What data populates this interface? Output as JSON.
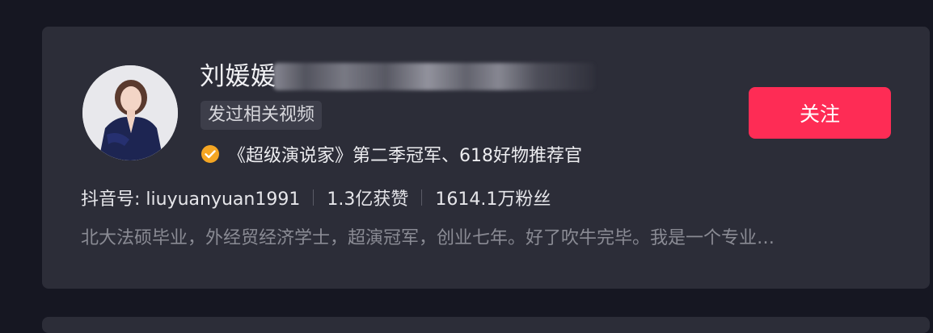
{
  "profile": {
    "name": "刘媛媛",
    "tag": "发过相关视频",
    "verification": "《超级演说家》第二季冠军、618好物推荐官",
    "follow_label": "关注",
    "stats": {
      "id": "抖音号: liuyuanyuan1991",
      "likes": "1.3亿获赞",
      "fans": "1614.1万粉丝"
    },
    "bio": "北大法硕毕业，外经贸经济学士，超演冠军，创业七年。好了吹牛完毕。我是一个专业…"
  },
  "colors": {
    "background": "#161722",
    "card": "#2c2d38",
    "follow_button": "#fe2c55",
    "verify_badge": "#f5a623",
    "bio_text": "#8a8b94"
  },
  "icons": {
    "verify": "verified-badge-icon",
    "avatar": "user-avatar"
  }
}
